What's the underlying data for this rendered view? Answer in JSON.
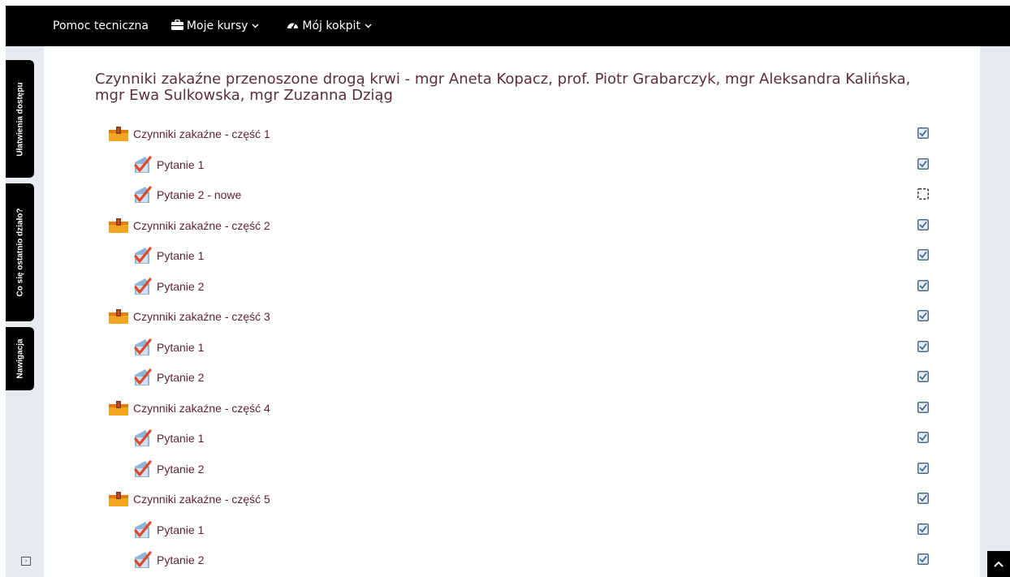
{
  "nav": {
    "help": "Pomoc tecniczna",
    "courses": "Moje kursy",
    "dashboard": "Mój kokpit"
  },
  "sidebar_tabs": {
    "accessibility": "Ułatwienia dostępu",
    "recent": "Co się ostatnio działo?",
    "navigation": "Nawigacja"
  },
  "title": "Czynniki zakaźne przenoszone drogą krwi - mgr Aneta Kopacz, prof. Piotr Grabarczyk, mgr Aleksandra Kalińska, mgr Ewa Sulkowska, mgr Zuzanna Dziąg",
  "items": [
    {
      "label": "Czynniki zakaźne - część 1",
      "type": "section",
      "completed": true
    },
    {
      "label": "Pytanie 1",
      "type": "question",
      "completed": true
    },
    {
      "label": "Pytanie 2 - nowe",
      "type": "question",
      "completed": false
    },
    {
      "label": "Czynniki zakaźne - część 2",
      "type": "section",
      "completed": true
    },
    {
      "label": "Pytanie 1",
      "type": "question",
      "completed": true
    },
    {
      "label": "Pytanie 2",
      "type": "question",
      "completed": true
    },
    {
      "label": "Czynniki zakaźne - część 3",
      "type": "section",
      "completed": true
    },
    {
      "label": "Pytanie 1",
      "type": "question",
      "completed": true
    },
    {
      "label": "Pytanie 2",
      "type": "question",
      "completed": true
    },
    {
      "label": "Czynniki zakaźne - część 4",
      "type": "section",
      "completed": true
    },
    {
      "label": "Pytanie 1",
      "type": "question",
      "completed": true
    },
    {
      "label": "Pytanie 2",
      "type": "question",
      "completed": true
    },
    {
      "label": "Czynniki zakaźne - część 5",
      "type": "section",
      "completed": true
    },
    {
      "label": "Pytanie 1",
      "type": "question",
      "completed": true
    },
    {
      "label": "Pytanie 2",
      "type": "question",
      "completed": true
    }
  ],
  "colors": {
    "topbar": "#000000",
    "title": "#5a2e3e",
    "link": "#5d1f36",
    "checkbox": "#4a6a8c"
  },
  "icons": {
    "section": "folder-icon",
    "question": "quiz-check-icon",
    "completion_done": "checkbox-checked-icon",
    "completion_todo": "checkbox-empty-icon"
  }
}
